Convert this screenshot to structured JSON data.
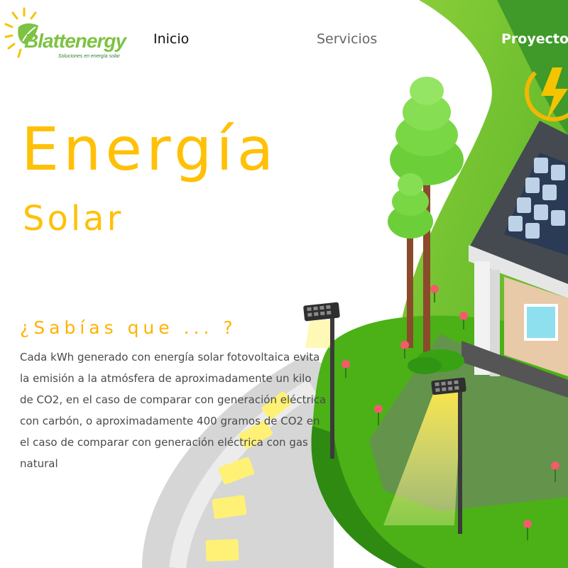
{
  "brand": {
    "name": "Blattenergy",
    "tagline": "Soluciones en energía solar"
  },
  "nav": {
    "items": [
      {
        "label": "Inicio"
      },
      {
        "label": "Servicios"
      },
      {
        "label": "Proyectos"
      }
    ]
  },
  "hero": {
    "title": "Energía",
    "subtitle": "Solar"
  },
  "fact": {
    "question": "¿Sabías que ... ?",
    "text": "Cada kWh generado con energía solar fotovoltaica evita la emisión a la atmósfera de aproximadamente un kilo de CO2, en el caso de comparar con generación eléctrica con carbón, o aproximadamente 400 gramos de CO2 en el caso de comparar con generación eléctrica con gas natural"
  },
  "colors": {
    "accent_yellow": "#ffc107",
    "logo_green": "#7dc243",
    "grass_green": "#4caf1a",
    "text_gray": "#4a4a4a"
  },
  "icons": [
    "sun-leaf-logo-icon",
    "lightning-bolt-icon",
    "solar-panel-icon",
    "tree-icon",
    "street-lamp-icon",
    "flower-icon",
    "house-icon"
  ]
}
